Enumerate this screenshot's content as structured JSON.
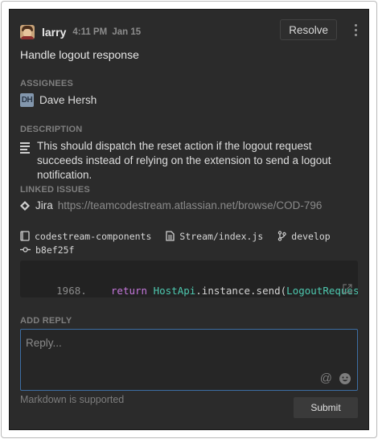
{
  "header": {
    "author": "larry",
    "time": "4:11 PM",
    "date": "Jan 15",
    "resolve_label": "Resolve",
    "menu_icon": "kebab-menu-icon"
  },
  "title": "Handle logout response",
  "assignees": {
    "label": "ASSIGNEES",
    "items": [
      {
        "initials": "DH",
        "name": "Dave Hersh"
      }
    ]
  },
  "description": {
    "label": "DESCRIPTION",
    "icon": "text-lines-icon",
    "text": "This should dispatch the reset action if the logout request succeeds instead of relying on the extension to send a logout notification."
  },
  "linked_issues": {
    "label": "LINKED ISSUES",
    "provider": "Jira",
    "url": "https://teamcodestream.atlassian.net/browse/COD-796"
  },
  "code_meta": {
    "repo": "codestream-components",
    "file": "Stream/index.js",
    "branch": "develop",
    "commit": "b8ef25f"
  },
  "code_snippet": {
    "line_number": "1968.",
    "keyword": "return",
    "class_name": "HostApi",
    "middle": ".instance.send(",
    "arg": "LogoutRequestType",
    "tail": ","
  },
  "reply": {
    "label": "ADD REPLY",
    "placeholder": "Reply...",
    "at_icon": "@",
    "markdown_note": "Markdown is supported",
    "submit_label": "Submit"
  },
  "colors": {
    "panel_bg": "#2b2b2b",
    "accent_border": "#3d6ea4",
    "keyword": "#c678dd",
    "class": "#4ec9b0"
  }
}
